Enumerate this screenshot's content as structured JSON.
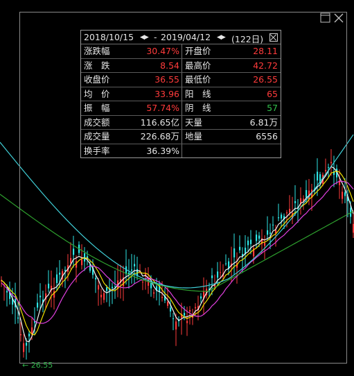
{
  "stats_popup": {
    "date_start": "2018/10/15",
    "date_sep": "-",
    "date_end": "2019/04/12",
    "days": "(122日)",
    "rows": [
      {
        "l1": "涨跌幅",
        "v1": "30.47%",
        "c1": "#ff3b3b",
        "l2": "开盘价",
        "v2": "28.11",
        "c2": "#ff3b3b"
      },
      {
        "l1": "涨　跌",
        "v1": "8.54",
        "c1": "#ff3b3b",
        "l2": "最高价",
        "v2": "42.72",
        "c2": "#ff3b3b"
      },
      {
        "l1": "收盘价",
        "v1": "36.55",
        "c1": "#ff3b3b",
        "l2": "最低价",
        "v2": "26.55",
        "c2": "#ff3b3b"
      },
      {
        "l1": "均　价",
        "v1": "33.96",
        "c1": "#ff3b3b",
        "l2": "阳　线",
        "v2": "65",
        "c2": "#ff3b3b"
      },
      {
        "l1": "振　幅",
        "v1": "57.74%",
        "c1": "#ff3b3b",
        "l2": "阴　线",
        "v2": "57",
        "c2": "#33c24d"
      },
      {
        "l1": "成交额",
        "v1": "116.65亿",
        "c1": "#e6e6e6",
        "l2": "天量",
        "v2": "6.81万",
        "c2": "#e6e6e6"
      },
      {
        "l1": "成交量",
        "v1": "226.68万",
        "c1": "#e6e6e6",
        "l2": "地量",
        "v2": "6556",
        "c2": "#e6e6e6"
      },
      {
        "l1": "换手率",
        "v1": "36.39%",
        "c1": "#e6e6e6",
        "l2": "",
        "v2": "",
        "c2": "#e6e6e6"
      }
    ]
  },
  "min_price_marker": "← 26.55",
  "colors": {
    "up": "#ff3b3b",
    "down": "#2ee6e6",
    "ma5": "#f5f5f5",
    "ma10": "#f0e000",
    "ma20": "#e040e0",
    "ma60": "#2ea02e",
    "ma120": "#40d0d8"
  },
  "icons": {
    "restore": "restore-window-icon",
    "close": "close-window-icon",
    "popup_close": "close-box-icon"
  }
}
